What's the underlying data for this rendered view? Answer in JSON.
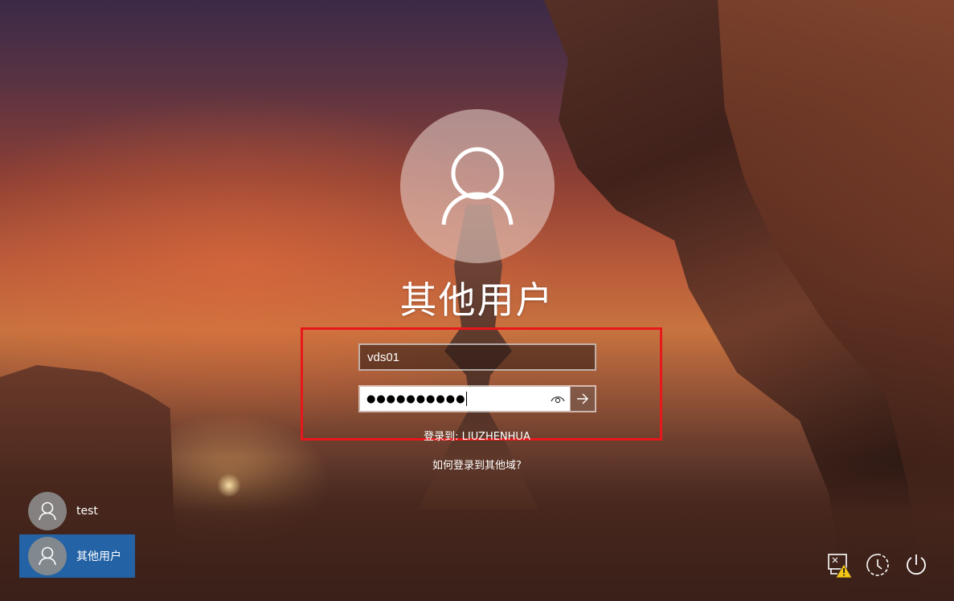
{
  "login": {
    "display_name": "其他用户",
    "username_value": "vds01",
    "password_mask": "●●●●●●●●●●",
    "sign_in_to": "登录到: LIUZHENHUA",
    "other_domain_link": "如何登录到其他域?"
  },
  "user_list": [
    {
      "name": "test",
      "selected": false
    },
    {
      "name": "其他用户",
      "selected": true
    }
  ],
  "system_icons": [
    "network-warning-icon",
    "ease-of-access-icon",
    "power-icon"
  ],
  "colors": {
    "highlight_box": "#e8171a",
    "selected_tile": "#1e6ebe",
    "warning": "#f5c518"
  }
}
